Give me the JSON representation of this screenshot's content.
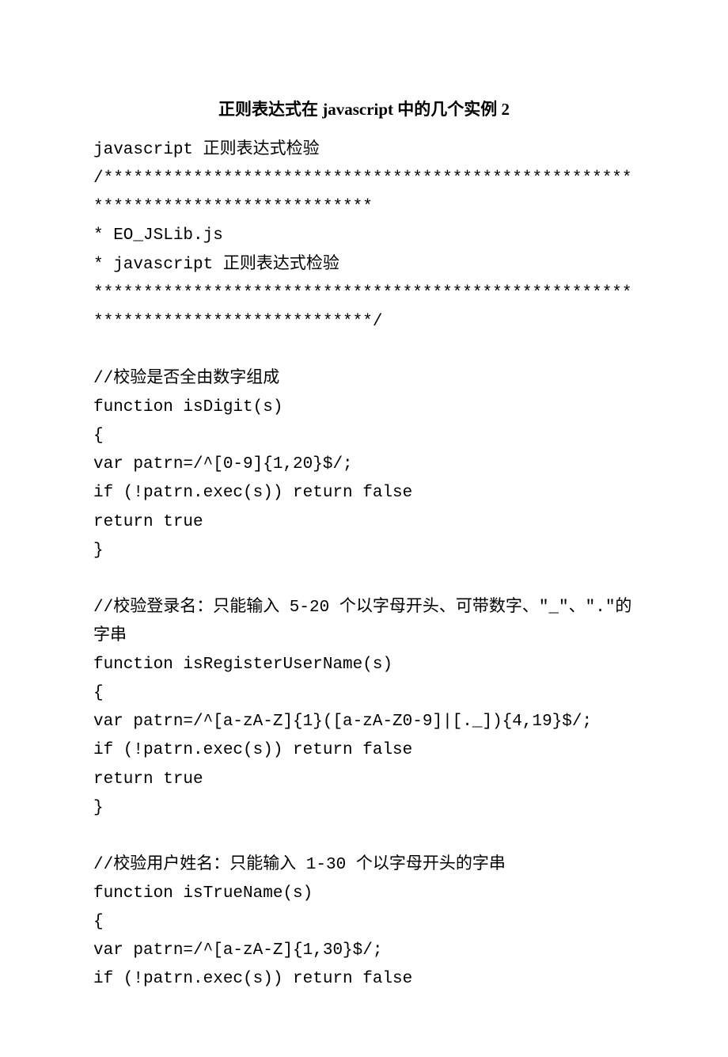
{
  "title": "正则表达式在 javascript 中的几个实例 2",
  "lines": [
    "javascript 正则表达式检验",
    "/*********************************************************************************",
    "* EO_JSLib.js",
    "* javascript 正则表达式检验",
    "**********************************************************************************/",
    "",
    "//校验是否全由数字组成",
    "function isDigit(s)",
    "{",
    "var patrn=/^[0-9]{1,20}$/;",
    "if (!patrn.exec(s)) return false",
    "return true",
    "}",
    "",
    "//校验登录名：只能输入 5-20 个以字母开头、可带数字、\"_\"、\".\"的字串",
    "function isRegisterUserName(s)",
    "{",
    "var patrn=/^[a-zA-Z]{1}([a-zA-Z0-9]|[._]){4,19}$/;",
    "if (!patrn.exec(s)) return false",
    "return true",
    "}",
    "",
    "//校验用户姓名：只能输入 1-30 个以字母开头的字串",
    "function isTrueName(s)",
    "{",
    "var patrn=/^[a-zA-Z]{1,30}$/;",
    "if (!patrn.exec(s)) return false"
  ]
}
